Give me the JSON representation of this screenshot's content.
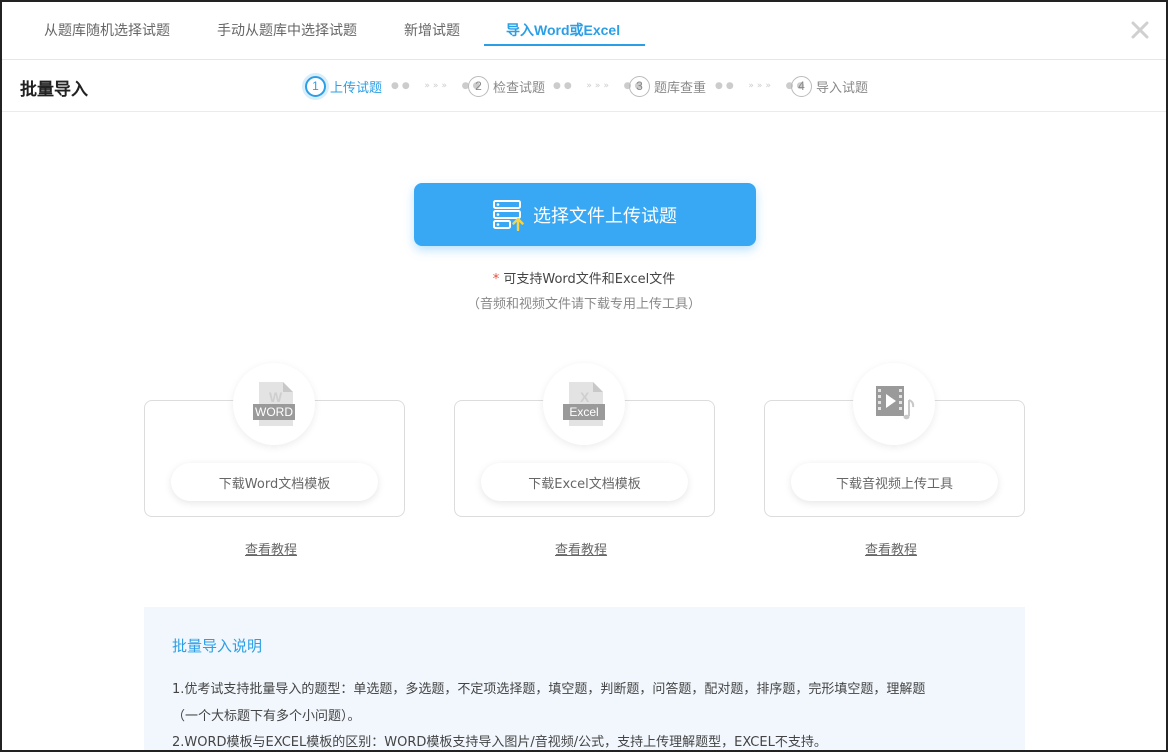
{
  "tabs": [
    {
      "label": "从题库随机选择试题"
    },
    {
      "label": "手动从题库中选择试题"
    },
    {
      "label": "新增试题"
    },
    {
      "label": "导入Word或Excel"
    }
  ],
  "active_tab": "导入Word或Excel",
  "close_icon": "close-icon",
  "header": {
    "title": "批量导入",
    "steps": [
      {
        "num": "1",
        "label": "上传试题"
      },
      {
        "num": "2",
        "label": "检查试题"
      },
      {
        "num": "3",
        "label": "题库查重"
      },
      {
        "num": "4",
        "label": "导入试题"
      }
    ],
    "active_step": "1"
  },
  "upload": {
    "button_label": "选择文件上传试题",
    "icon": "upload-file-icon",
    "required_mark": "*",
    "support_text": "可支持Word文件和Excel文件",
    "note": "（音频和视频文件请下载专用上传工具）"
  },
  "cards": [
    {
      "icon": "word-file-icon",
      "icon_text": "WORD",
      "label": "下载Word文档模板",
      "tutorial": "查看教程"
    },
    {
      "icon": "excel-file-icon",
      "icon_text": "Excel",
      "label": "下载Excel文档模板",
      "tutorial": "查看教程"
    },
    {
      "icon": "video-file-icon",
      "label": "下载音视频上传工具",
      "tutorial": "查看教程"
    }
  ],
  "info": {
    "title": "批量导入说明",
    "lines": [
      "1.优考试支持批量导入的题型：单选题，多选题，不定项选择题，填空题，判断题，问答题，配对题，排序题，完形填空题，理解题",
      "（一个大标题下有多个小问题）。",
      "2.WORD模板与EXCEL模板的区别：WORD模板支持导入图片/音视频/公式，支持上传理解题型，EXCEL不支持。"
    ]
  },
  "colors": {
    "accent": "#2b9fe6",
    "button": "#38a8f5",
    "required": "#e84c3d",
    "info_bg": "#f1f7fd"
  }
}
